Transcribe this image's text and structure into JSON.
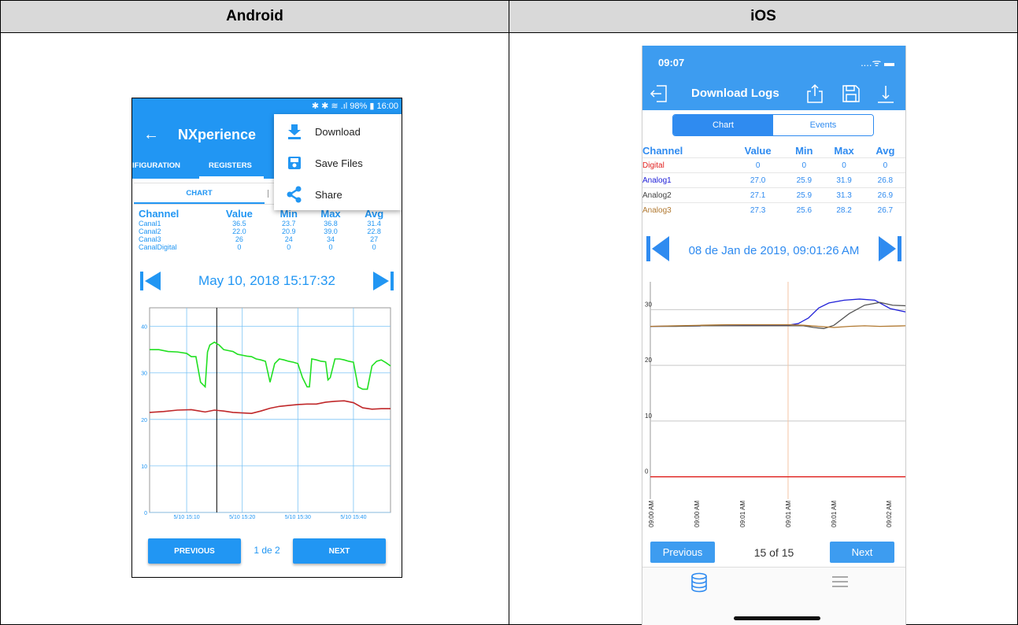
{
  "headers": {
    "android": "Android",
    "ios": "iOS"
  },
  "android": {
    "status_bar": "✱ ✱ ≋ .ıl 98% ▮ 16:00",
    "app_title": "NXperience",
    "tabs": [
      "IFIGURATION",
      "REGISTERS"
    ],
    "segment_chart": "CHART",
    "menu": [
      {
        "label": "Download",
        "icon": "download-icon"
      },
      {
        "label": "Save Files",
        "icon": "save-icon"
      },
      {
        "label": "Share",
        "icon": "share-icon"
      }
    ],
    "table": {
      "headers": [
        "Channel",
        "Value",
        "Min",
        "Max",
        "Avg"
      ],
      "rows": [
        [
          "Canal1",
          "36.5",
          "23.7",
          "36.8",
          "31.4"
        ],
        [
          "Canal2",
          "22.0",
          "20.9",
          "39.0",
          "22.8"
        ],
        [
          "Canal3",
          "26",
          "24",
          "34",
          "27"
        ],
        [
          "CanalDigital",
          "0",
          "0",
          "0",
          "0"
        ]
      ]
    },
    "date": "May 10, 2018 15:17:32",
    "buttons": {
      "previous": "PREVIOUS",
      "next": "NEXT"
    },
    "page": "1 de 2",
    "colors": {
      "accent": "#2196f3",
      "series_green": "#22e022",
      "series_red": "#c0282a"
    }
  },
  "ios": {
    "time": "09:07",
    "status_icons": "....ᯤ ▬",
    "title": "Download Logs",
    "segments": {
      "chart": "Chart",
      "events": "Events"
    },
    "table": {
      "headers": [
        "Channel",
        "Value",
        "Min",
        "Max",
        "Avg"
      ],
      "rows": [
        {
          "name": "Digital",
          "color": "#e0201e",
          "values": [
            "0",
            "0",
            "0",
            "0"
          ]
        },
        {
          "name": "Analog1",
          "color": "#2020d8",
          "values": [
            "27.0",
            "25.9",
            "31.9",
            "26.8"
          ]
        },
        {
          "name": "Analog2",
          "color": "#444444",
          "values": [
            "27.1",
            "25.9",
            "31.3",
            "26.9"
          ]
        },
        {
          "name": "Analog3",
          "color": "#b07830",
          "values": [
            "27.3",
            "25.6",
            "28.2",
            "26.7"
          ]
        }
      ]
    },
    "date": "08 de Jan de 2019, 09:01:26 AM",
    "buttons": {
      "previous": "Previous",
      "next": "Next"
    },
    "page": "15 of 15",
    "tab_icons": [
      "database-icon",
      "list-icon"
    ],
    "colors": {
      "accent": "#3d9cf0"
    }
  },
  "chart_data": [
    {
      "type": "line",
      "title": "",
      "x_tick_labels": [
        "5/10 15:10",
        "5/10 15:20",
        "5/10 15:30",
        "5/10 15:40"
      ],
      "y_ticks": [
        0,
        10,
        20,
        30,
        40
      ],
      "ylim": [
        0,
        44
      ],
      "xlim": [
        0,
        52
      ],
      "grid": true,
      "cursor_x": 14.5,
      "series": [
        {
          "color": "#22e022",
          "x": [
            0,
            2,
            4,
            6,
            8,
            9,
            10,
            11,
            12,
            12.5,
            13,
            14,
            15,
            16,
            17,
            18,
            19,
            20,
            21,
            22,
            23,
            24,
            25,
            26,
            27,
            28,
            29,
            30,
            31,
            32,
            33,
            34,
            34.5,
            35,
            36,
            37,
            38,
            38.5,
            39,
            40,
            41,
            42,
            43,
            44,
            45,
            46,
            47,
            48,
            49,
            50,
            51,
            52
          ],
          "y": [
            35,
            35,
            34.6,
            34.5,
            34.2,
            33.5,
            33.5,
            28,
            27,
            34.5,
            36,
            36.6,
            36,
            35,
            34.8,
            34.6,
            34,
            33.8,
            33.6,
            33.5,
            33,
            32.8,
            32.5,
            28,
            32,
            33,
            32.8,
            32.5,
            32.3,
            32,
            29,
            27,
            27,
            33,
            32.8,
            32.5,
            32.4,
            28.5,
            29,
            33,
            33,
            32.8,
            32.5,
            32.3,
            27,
            26.5,
            26.5,
            31.5,
            32.5,
            32.8,
            32.2,
            31.5
          ]
        },
        {
          "color": "#c0282a",
          "x": [
            0,
            3,
            6,
            9,
            12,
            14,
            16,
            18,
            20,
            22,
            24,
            26,
            28,
            30,
            32,
            34,
            36,
            38,
            40,
            42,
            44,
            46,
            48,
            50,
            52
          ],
          "y": [
            21.5,
            21.7,
            22,
            22.1,
            21.6,
            22,
            21.8,
            21.5,
            21.4,
            21.3,
            21.8,
            22.4,
            22.8,
            23,
            23.2,
            23.3,
            23.3,
            23.7,
            23.9,
            24,
            23.6,
            22.5,
            22.2,
            22.3,
            22.3
          ]
        }
      ]
    },
    {
      "type": "line",
      "title": "",
      "x_tick_labels": [
        "09:00 AM",
        "09:00 AM",
        "09:01 AM",
        "09:01 AM",
        "09:01 AM",
        "09:02 AM"
      ],
      "y_ticks": [
        0,
        10,
        20,
        30
      ],
      "ylim": [
        -4,
        35
      ],
      "xlim": [
        0,
        100
      ],
      "grid": true,
      "cursor_x": 54,
      "series": [
        {
          "name": "Digital",
          "color": "#e0201e",
          "x": [
            0,
            100
          ],
          "y": [
            0,
            0
          ]
        },
        {
          "name": "Analog1",
          "color": "#2020d8",
          "x": [
            0,
            10,
            20,
            30,
            40,
            50,
            54,
            58,
            62,
            66,
            70,
            76,
            82,
            88,
            94,
            100
          ],
          "y": [
            27,
            27.05,
            27.1,
            27.1,
            27.15,
            27.2,
            27.2,
            27.5,
            28.5,
            30.3,
            31.2,
            31.7,
            31.9,
            31.7,
            30.2,
            29.6
          ]
        },
        {
          "name": "Analog2",
          "color": "#555555",
          "x": [
            0,
            10,
            20,
            30,
            40,
            50,
            54,
            60,
            64,
            68,
            72,
            78,
            84,
            90,
            95,
            100
          ],
          "y": [
            27,
            27,
            27.1,
            27.1,
            27.1,
            27.1,
            27.1,
            27.1,
            26.8,
            26.6,
            27.2,
            29.3,
            30.8,
            31.3,
            30.8,
            30.7
          ]
        },
        {
          "name": "Analog3",
          "color": "#b07830",
          "x": [
            0,
            10,
            20,
            30,
            40,
            50,
            54,
            60,
            66,
            72,
            78,
            84,
            90,
            100
          ],
          "y": [
            27,
            27.1,
            27.2,
            27.3,
            27.3,
            27.3,
            27.3,
            27.2,
            27,
            26.8,
            27,
            27.1,
            27,
            27.1
          ]
        }
      ]
    }
  ]
}
